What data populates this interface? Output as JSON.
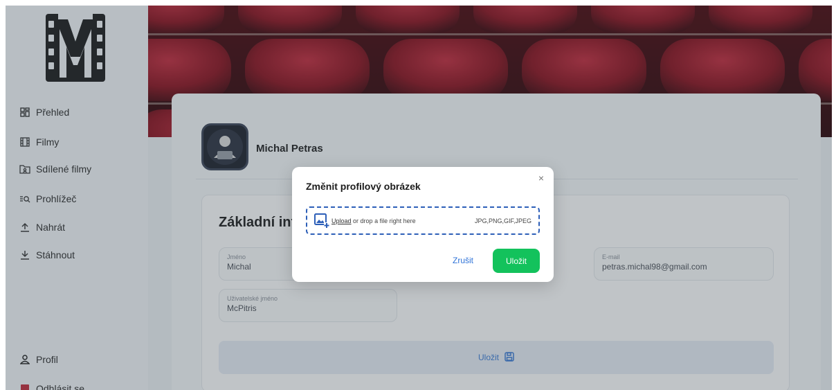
{
  "sidebar": {
    "items": [
      {
        "label": "Přehled",
        "icon": "dashboard-icon"
      },
      {
        "label": "Filmy",
        "icon": "film-icon"
      },
      {
        "label": "Sdílené filmy",
        "icon": "shared-folder-icon"
      },
      {
        "label": "Prohlížeč",
        "icon": "search-list-icon"
      },
      {
        "label": "Nahrát",
        "icon": "upload-icon"
      },
      {
        "label": "Stáhnout",
        "icon": "download-icon"
      }
    ],
    "profile_label": "Profil",
    "logout_label": "Odhlásit se"
  },
  "profile": {
    "name": "Michal Petras"
  },
  "form": {
    "title": "Základní informace",
    "first_name_label": "Jméno",
    "first_name_value": "Michal",
    "email_label": "E-mail",
    "email_value": "petras.michal98@gmail.com",
    "username_label": "Uživatelské jméno",
    "username_value": "McPitris",
    "save_label": "Uložit"
  },
  "modal": {
    "title": "Změnit profilový obrázek",
    "close_symbol": "×",
    "upload_link": "Upload",
    "upload_text": "or drop a file right here",
    "file_types": "JPG,PNG,GIF,JPEG",
    "cancel_label": "Zrušit",
    "save_label": "Uložit"
  },
  "colors": {
    "accent_green": "#13c25c",
    "link_blue": "#2f73d8",
    "dropzone_border": "#2d5fb8",
    "banner_red": "#8b0f1c"
  }
}
